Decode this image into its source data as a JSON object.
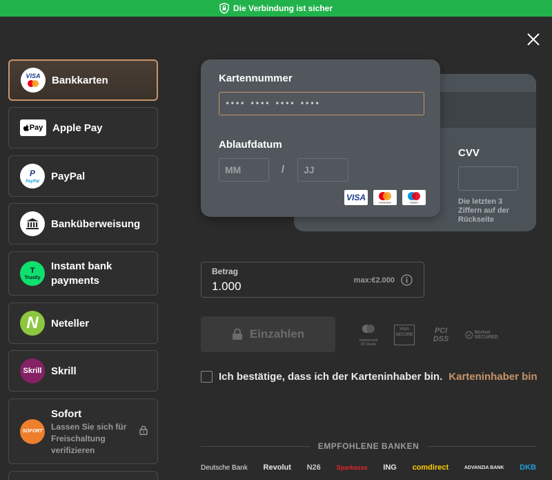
{
  "topbar": {
    "text": "Die Verbindung ist sicher",
    "color": "#21b24b"
  },
  "methods": [
    {
      "label": "Bankkarten",
      "active": true
    },
    {
      "label": "Apple Pay"
    },
    {
      "label": "PayPal",
      "icon_text": "PayPal"
    },
    {
      "label": "Banküberweisung"
    },
    {
      "label": "Instant bank payments",
      "icon_text": "Trustly"
    },
    {
      "label": "Neteller",
      "icon_text": "N"
    },
    {
      "label": "Skrill",
      "icon_text": "Skrill"
    },
    {
      "label": "Sofort",
      "sub": "Lassen Sie sich für Freischaltung verifizieren",
      "icon_text": "SOFORT"
    }
  ],
  "card": {
    "number_label": "Kartennummer",
    "number_placeholder": "•••• •••• •••• ••••",
    "expiry_label": "Ablaufdatum",
    "month_placeholder": "MM",
    "year_placeholder": "JJ",
    "separator": "/",
    "cvv_label": "CVV",
    "cvv_hint": "Die letzten 3 Ziffern auf der Rückseite",
    "brands": [
      "VISA",
      "mastercard",
      "maestro"
    ]
  },
  "amount": {
    "label": "Betrag",
    "value": "1.000",
    "max": "max:€2.000"
  },
  "pay_button": {
    "label": "Einzahlen"
  },
  "secure_logos": [
    "mastercard ID Check",
    "VISA SECURE",
    "PCI DSS",
    "Norton SECURED"
  ],
  "confirm": {
    "text": "Ich bestätige, dass ich der Karteninhaber bin.",
    "link": "Karteninhaber bin"
  },
  "banks": {
    "title": "EMPFOHLENE BANKEN",
    "list": [
      "Deutsche Bank",
      "Revolut",
      "N26",
      "Sparkasse",
      "ING",
      "comdirect",
      "ADVANZIA BANK",
      "DKB"
    ]
  },
  "colors": {
    "accent": "#c8956a",
    "background": "#2b2b2b",
    "card": "#51575c"
  }
}
